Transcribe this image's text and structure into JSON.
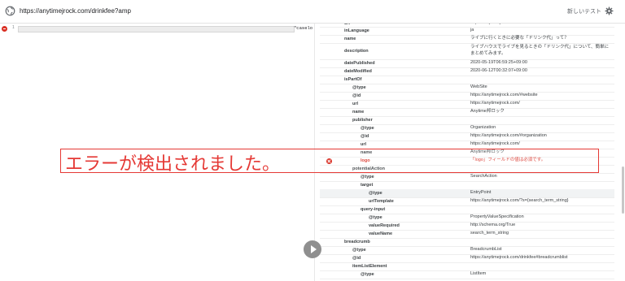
{
  "header": {
    "url": "https://anytimejrock.com/drinkfee?amp",
    "new_test": "新しいテスト"
  },
  "editor": {
    "line_number": "1",
    "code_tail": "\"caselo"
  },
  "annotation": {
    "error_message": "エラーが検出されました。"
  },
  "structured_data": {
    "rows": [
      {
        "key": "url",
        "value": "https://anytimejrock.com/drinkfee"
      },
      {
        "key": "inLanguage",
        "value": "ja"
      },
      {
        "key": "name",
        "value": "ライブに行くときに必要な「ドリンク代」って？"
      },
      {
        "key": "description",
        "value": "ライブハウスでライブを見るときの「ドリンク代」について、簡単にまとめてみます。"
      },
      {
        "key": "datePublished",
        "value": "2020-05-19T06:59:25+09:00"
      },
      {
        "key": "dateModified",
        "value": "2020-06-12T00:32:07+09:00"
      },
      {
        "key": "isPartOf",
        "value": ""
      },
      {
        "key": "@type",
        "value": "WebSite"
      },
      {
        "key": "@id",
        "value": "https://anytimejrock.com/#website"
      },
      {
        "key": "url",
        "value": "https://anytimejrock.com/"
      },
      {
        "key": "name",
        "value": "Anytime邦ロック"
      },
      {
        "key": "publisher",
        "value": ""
      },
      {
        "key": "@type",
        "value": "Organization"
      },
      {
        "key": "@id",
        "value": "https://anytimejrock.com/#organization"
      },
      {
        "key": "url",
        "value": "https://anytimejrock.com/"
      },
      {
        "key": "name",
        "value": "Anytime邦ロック"
      },
      {
        "key": "logo",
        "value": "「logo」フィールドの値は必須です。"
      },
      {
        "key": "potentialAction",
        "value": ""
      },
      {
        "key": "@type",
        "value": "SearchAction"
      },
      {
        "key": "target",
        "value": ""
      },
      {
        "key": "@type",
        "value": "EntryPoint"
      },
      {
        "key": "urlTemplate",
        "value": "https://anytimejrock.com/?s={search_term_string}"
      },
      {
        "key": "query-input",
        "value": ""
      },
      {
        "key": "@type",
        "value": "PropertyValueSpecification"
      },
      {
        "key": "valueRequired",
        "value": "http://schema.org/True"
      },
      {
        "key": "valueName",
        "value": "search_term_string"
      },
      {
        "key": "breadcrumb",
        "value": ""
      },
      {
        "key": "@type",
        "value": "BreadcrumbList"
      },
      {
        "key": "@id",
        "value": "https://anytimejrock.com/drinkfee#breadcrumblist"
      },
      {
        "key": "itemListElement",
        "value": ""
      },
      {
        "key": "@type",
        "value": "ListItem"
      }
    ]
  },
  "colors": {
    "error": "#d93025",
    "annotation": "#e53935"
  }
}
